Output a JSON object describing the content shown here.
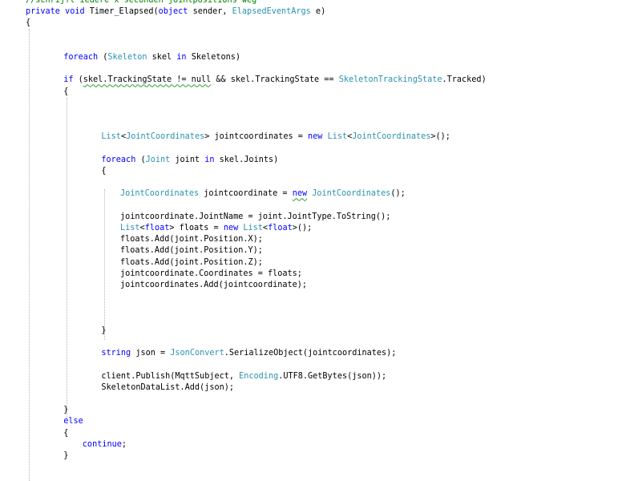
{
  "editor": {
    "lines": [
      {
        "indent": 0,
        "tokens": [
          {
            "t": "//schrijft iedere x seconden jointpositions weg",
            "c": "cm"
          }
        ]
      },
      {
        "indent": 0,
        "tokens": [
          {
            "t": "private",
            "c": "kw"
          },
          {
            "t": " "
          },
          {
            "t": "void",
            "c": "kw"
          },
          {
            "t": " Timer_Elapsed("
          },
          {
            "t": "object",
            "c": "kw"
          },
          {
            "t": " sender, "
          },
          {
            "t": "ElapsedEventArgs",
            "c": "type"
          },
          {
            "t": " e)"
          }
        ]
      },
      {
        "indent": 0,
        "tokens": [
          {
            "t": "{"
          }
        ]
      },
      {
        "indent": 0,
        "tokens": []
      },
      {
        "indent": 0,
        "tokens": []
      },
      {
        "indent": 2,
        "tokens": [
          {
            "t": "foreach",
            "c": "kw"
          },
          {
            "t": " ("
          },
          {
            "t": "Skeleton",
            "c": "type"
          },
          {
            "t": " skel "
          },
          {
            "t": "in",
            "c": "kw"
          },
          {
            "t": " Skeletons)"
          }
        ]
      },
      {
        "indent": 0,
        "tokens": []
      },
      {
        "indent": 2,
        "tokens": [
          {
            "t": "if",
            "c": "kw"
          },
          {
            "t": " ("
          },
          {
            "t": "skel.TrackingState != null",
            "sq": true
          },
          {
            "t": " && skel.TrackingState == "
          },
          {
            "t": "SkeletonTrackingState",
            "c": "type"
          },
          {
            "t": ".Tracked)"
          }
        ]
      },
      {
        "indent": 2,
        "tokens": [
          {
            "t": "{"
          }
        ]
      },
      {
        "indent": 0,
        "tokens": []
      },
      {
        "indent": 0,
        "tokens": []
      },
      {
        "indent": 0,
        "tokens": []
      },
      {
        "indent": 4,
        "tokens": [
          {
            "t": "List",
            "c": "type"
          },
          {
            "t": "<"
          },
          {
            "t": "JointCoordinates",
            "c": "type"
          },
          {
            "t": "> jointcoordinates = "
          },
          {
            "t": "new",
            "c": "kw"
          },
          {
            "t": " "
          },
          {
            "t": "List",
            "c": "type"
          },
          {
            "t": "<"
          },
          {
            "t": "JointCoordinates",
            "c": "type"
          },
          {
            "t": ">();"
          }
        ]
      },
      {
        "indent": 0,
        "tokens": []
      },
      {
        "indent": 4,
        "tokens": [
          {
            "t": "foreach",
            "c": "kw"
          },
          {
            "t": " ("
          },
          {
            "t": "Joint",
            "c": "type"
          },
          {
            "t": " joint "
          },
          {
            "t": "in",
            "c": "kw"
          },
          {
            "t": " skel.Joints)"
          }
        ]
      },
      {
        "indent": 4,
        "tokens": [
          {
            "t": "{"
          }
        ]
      },
      {
        "indent": 0,
        "tokens": []
      },
      {
        "indent": 5,
        "tokens": [
          {
            "t": "JointCoordinates",
            "c": "type"
          },
          {
            "t": " jointcoordinate = "
          },
          {
            "t": "new",
            "c": "kw",
            "sq": true
          },
          {
            "t": " "
          },
          {
            "t": "JointCoordinates",
            "c": "type"
          },
          {
            "t": "();"
          }
        ]
      },
      {
        "indent": 0,
        "tokens": []
      },
      {
        "indent": 5,
        "tokens": [
          {
            "t": "jointcoordinate.JointName = joint.JointType.ToString();"
          }
        ]
      },
      {
        "indent": 5,
        "tokens": [
          {
            "t": "List",
            "c": "type"
          },
          {
            "t": "<"
          },
          {
            "t": "float",
            "c": "kw"
          },
          {
            "t": "> floats = "
          },
          {
            "t": "new",
            "c": "kw"
          },
          {
            "t": " "
          },
          {
            "t": "List",
            "c": "type"
          },
          {
            "t": "<"
          },
          {
            "t": "float",
            "c": "kw"
          },
          {
            "t": ">();"
          }
        ]
      },
      {
        "indent": 5,
        "tokens": [
          {
            "t": "floats.Add(joint.Position.X);"
          }
        ]
      },
      {
        "indent": 5,
        "tokens": [
          {
            "t": "floats.Add(joint.Position.Y);"
          }
        ]
      },
      {
        "indent": 5,
        "tokens": [
          {
            "t": "floats.Add(joint.Position.Z);"
          }
        ]
      },
      {
        "indent": 5,
        "tokens": [
          {
            "t": "jointcoordinate.Coordinates = floats;"
          }
        ]
      },
      {
        "indent": 5,
        "tokens": [
          {
            "t": "jointcoordinates.Add(jointcoordinate);"
          }
        ]
      },
      {
        "indent": 0,
        "tokens": []
      },
      {
        "indent": 0,
        "tokens": []
      },
      {
        "indent": 0,
        "tokens": []
      },
      {
        "indent": 4,
        "tokens": [
          {
            "t": "}"
          }
        ]
      },
      {
        "indent": 0,
        "tokens": []
      },
      {
        "indent": 4,
        "tokens": [
          {
            "t": "string",
            "c": "kw"
          },
          {
            "t": " json = "
          },
          {
            "t": "JsonConvert",
            "c": "type"
          },
          {
            "t": ".SerializeObject(jointcoordinates);"
          }
        ]
      },
      {
        "indent": 0,
        "tokens": []
      },
      {
        "indent": 4,
        "tokens": [
          {
            "t": "client.Publish(MqttSubject, "
          },
          {
            "t": "Encoding",
            "c": "type"
          },
          {
            "t": ".UTF8.GetBytes(json));"
          }
        ]
      },
      {
        "indent": 4,
        "tokens": [
          {
            "t": "SkeletonDataList.Add(json);"
          }
        ]
      },
      {
        "indent": 0,
        "tokens": []
      },
      {
        "indent": 2,
        "tokens": [
          {
            "t": "}"
          }
        ]
      },
      {
        "indent": 2,
        "tokens": [
          {
            "t": "else",
            "c": "kw"
          }
        ]
      },
      {
        "indent": 2,
        "tokens": [
          {
            "t": "{"
          }
        ]
      },
      {
        "indent": 3,
        "tokens": [
          {
            "t": "continue",
            "c": "kw"
          },
          {
            "t": ";"
          }
        ]
      },
      {
        "indent": 2,
        "tokens": [
          {
            "t": "}"
          }
        ]
      },
      {
        "indent": 0,
        "tokens": []
      }
    ]
  },
  "colors": {
    "keyword": "#0000ff",
    "type": "#2b91af",
    "comment": "#008000",
    "text": "#000000",
    "squiggle": "#2aa02a",
    "indent_guide": "#b5b5b5",
    "background": "#ffffff"
  }
}
